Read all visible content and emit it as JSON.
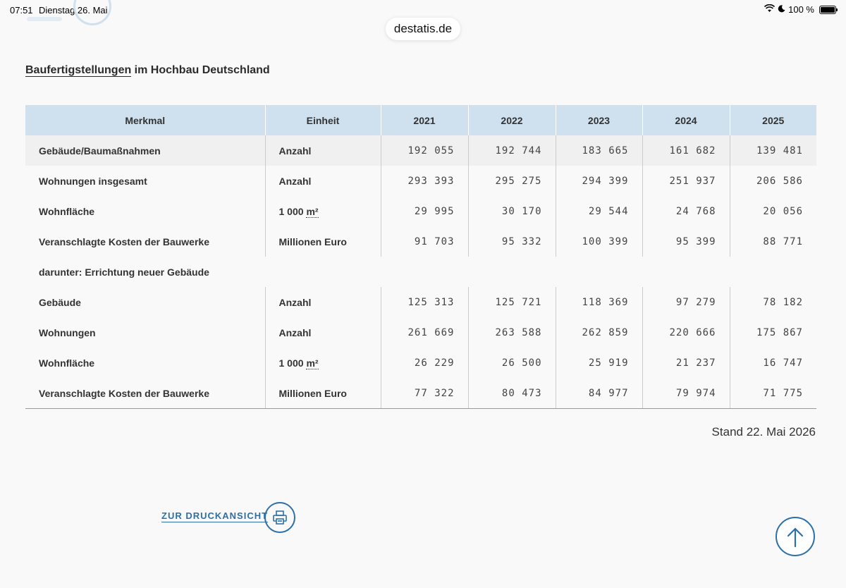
{
  "status_bar": {
    "time": "07:51",
    "date": "Dienstag 26. Mai",
    "battery": "100 %",
    "icons": [
      "wifi-icon",
      "moon-icon",
      "battery-icon"
    ]
  },
  "browser": {
    "url": "destatis.de"
  },
  "page": {
    "title_link": "Baufertigstellungen",
    "title_rest": " im Hochbau Deutschland"
  },
  "table": {
    "headers": [
      "Merkmal",
      "Einheit",
      "2021",
      "2022",
      "2023",
      "2024",
      "2025"
    ],
    "rows": [
      {
        "label": "Gebäude/Baumaßnahmen",
        "unit": "Anzahl",
        "values": [
          "192 055",
          "192 744",
          "183 665",
          "161 682",
          "139 481"
        ]
      },
      {
        "label": "Wohnungen insgesamt",
        "unit": "Anzahl",
        "values": [
          "293 393",
          "295 275",
          "294 399",
          "251 937",
          "206 586"
        ]
      },
      {
        "label": "Wohnfläche",
        "unit_prefix": "1 000 ",
        "unit_abbr": "m²",
        "values": [
          "29 995",
          "30 170",
          "29 544",
          "24 768",
          "20 056"
        ]
      },
      {
        "label": "Veranschlagte Kosten der Bauwerke",
        "unit": "Millionen Euro",
        "values": [
          "91 703",
          "95 332",
          "100 399",
          "95 399",
          "88 771"
        ]
      },
      {
        "section": "darunter: Errichtung neuer Gebäude"
      },
      {
        "label": "Gebäude",
        "unit": "Anzahl",
        "values": [
          "125 313",
          "125 721",
          "118 369",
          "97 279",
          "78 182"
        ]
      },
      {
        "label": "Wohnungen",
        "unit": "Anzahl",
        "values": [
          "261 669",
          "263 588",
          "262 859",
          "220 666",
          "175 867"
        ]
      },
      {
        "label": "Wohnfläche",
        "unit_prefix": "1 000 ",
        "unit_abbr": "m²",
        "values": [
          "26 229",
          "26 500",
          "25 919",
          "21 237",
          "16 747"
        ]
      },
      {
        "label": "Veranschlagte Kosten der Bauwerke",
        "unit": "Millionen Euro",
        "values": [
          "77 322",
          "80 473",
          "84 977",
          "79 974",
          "71 775"
        ]
      }
    ]
  },
  "stand": "Stand 22. Mai 2026",
  "print": {
    "label": "ZUR DRUCKANSICHT",
    "icon": "printer-icon"
  },
  "to_top": {
    "icon": "arrow-up-icon"
  },
  "colors": {
    "header_bg": "#cfe0ee",
    "accent": "#2d6fa8",
    "row_shade": "#f0f0f0"
  }
}
